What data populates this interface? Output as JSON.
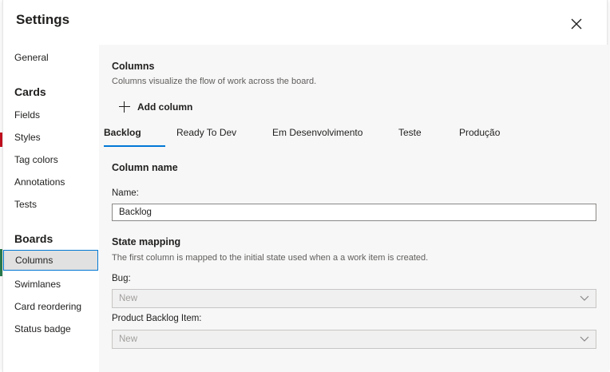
{
  "dialog": {
    "title": "Settings",
    "close_icon": "close-icon"
  },
  "sidebar": {
    "general": "General",
    "cards_heading": "Cards",
    "cards_items": [
      "Fields",
      "Styles",
      "Tag colors",
      "Annotations",
      "Tests"
    ],
    "boards_heading": "Boards",
    "boards_items": [
      "Columns",
      "Swimlanes",
      "Card reordering",
      "Status badge"
    ],
    "selected": "Columns"
  },
  "main": {
    "columns_title": "Columns",
    "columns_desc": "Columns visualize the flow of work across the board.",
    "add_column_label": "Add column",
    "add_icon": "plus-icon",
    "tabs": [
      "Backlog",
      "Ready To Dev",
      "Em Desenvolvimento",
      "Teste",
      "Produção"
    ],
    "active_tab": "Backlog",
    "column_name_title": "Column name",
    "name_label": "Name:",
    "name_value": "Backlog",
    "state_mapping_title": "State mapping",
    "state_mapping_desc": "The first column is mapped to the initial state used when a a work item is created.",
    "bug_label": "Bug:",
    "bug_value": "New",
    "pbi_label": "Product Backlog Item:",
    "pbi_value": "New",
    "dropdown_icon": "chevron-down-icon"
  },
  "colors": {
    "accent": "#0078d4",
    "panel_bg": "#f7f7f7",
    "selected_bg": "#e1e1e1"
  }
}
